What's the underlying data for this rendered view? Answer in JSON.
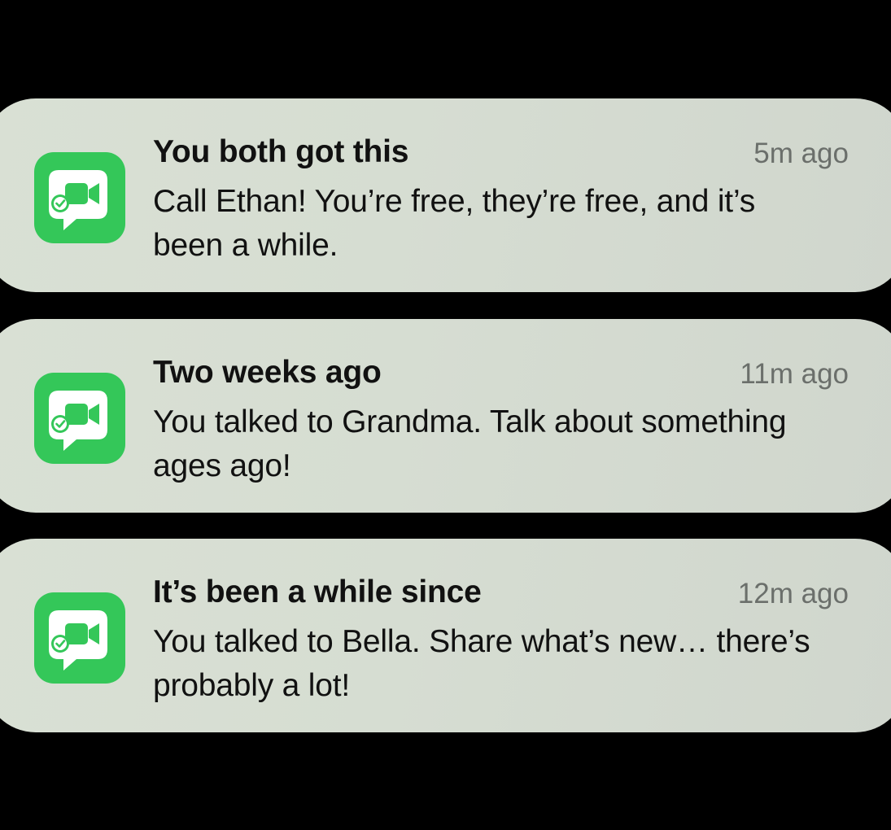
{
  "notifications": [
    {
      "title": "You both got this",
      "time": "5m ago",
      "body": "Call Ethan! You’re free, they’re free, and it’s been a while.",
      "app_icon": "facetime-check-icon"
    },
    {
      "title": "Two weeks ago",
      "time": "11m ago",
      "body": "You talked to Grandma. Talk about something ages ago!",
      "app_icon": "facetime-check-icon"
    },
    {
      "title": "It’s been a while since",
      "time": "12m ago",
      "body": "You talked to Bella. Share what’s new… there’s probably a lot!",
      "app_icon": "facetime-check-icon"
    }
  ],
  "colors": {
    "background": "#000000",
    "card": "#d6ddd2",
    "app_icon": "#34c759",
    "title_text": "#111111",
    "time_text": "#6b6f6b"
  }
}
